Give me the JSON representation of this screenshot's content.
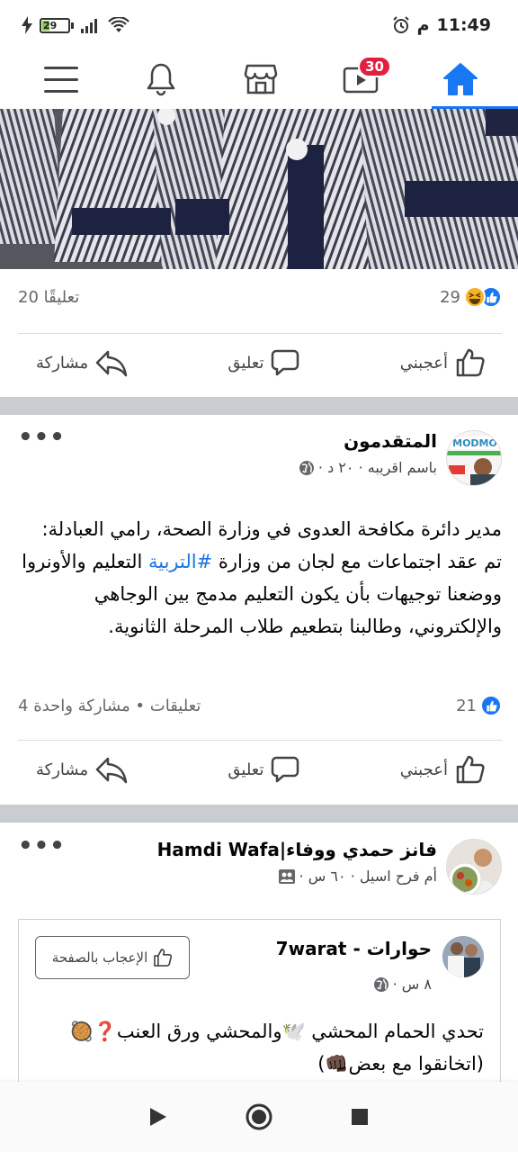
{
  "status_bar": {
    "battery_level": "29",
    "time": "11:49",
    "period": "م"
  },
  "nav": {
    "items": [
      {
        "name": "menu",
        "icon": "menu-icon"
      },
      {
        "name": "notifications",
        "icon": "bell-icon"
      },
      {
        "name": "marketplace",
        "icon": "store-icon"
      },
      {
        "name": "watch",
        "icon": "video-icon",
        "badge": "30"
      },
      {
        "name": "home",
        "icon": "home-icon",
        "active": true
      }
    ],
    "accent": "#1877f2"
  },
  "post1": {
    "reactions_count": "29",
    "comments": "20 تعليقًا",
    "actions": {
      "like": "أعجبني",
      "comment": "تعليق",
      "share": "مشاركة"
    }
  },
  "post2": {
    "author": "المتقدمون",
    "meta": "باسم اقريبه · ٢٠ د ·",
    "text_part1": "مدير دائرة مكافحة العدوى في وزارة الصحة، رامي العبادلة: تم عقد اجتماعات مع لجان من وزارة ",
    "hashtag": "#التربية",
    "text_part2": " التعليم والأونروا ووضعنا توجيهات بأن يكون التعليم مدمج بين الوجاهي والإلكتروني، وطالبنا بتطعيم طلاب المرحلة الثانوية.",
    "reactions_count": "21",
    "stats": "4 تعليقات • مشاركة واحدة",
    "actions": {
      "like": "أعجبني",
      "comment": "تعليق",
      "share": "مشاركة"
    }
  },
  "post3": {
    "author": "فانز حمدي ووفاء|Hamdi Wafa",
    "meta": "أم فرح اسيل · ٦٠ س ·",
    "shared": {
      "page_name": "حوارات - 7warat",
      "meta": "٨ س ·",
      "like_page_label": "الإعجاب بالصفحة",
      "text_line1": "تحدي الحمام المحشي 🕊️والمحشي ورق العنب❓🥘",
      "text_line2": "(اتخانقوا مع بعض👊🏿)"
    }
  }
}
